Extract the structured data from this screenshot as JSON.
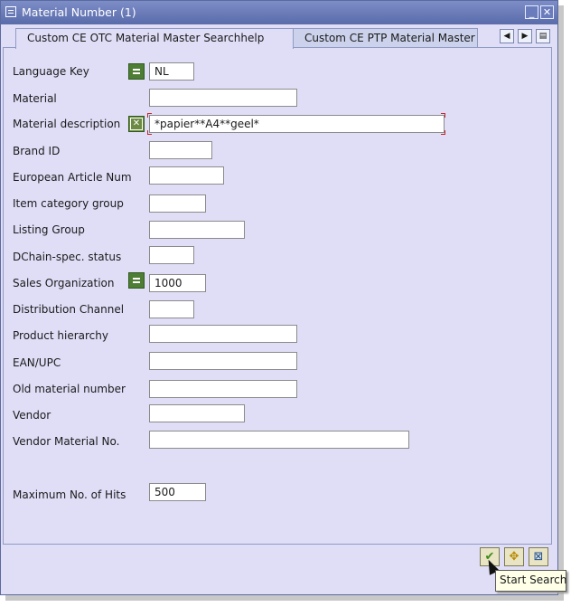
{
  "window": {
    "title": "Material Number (1)"
  },
  "tabs": [
    {
      "label": "Custom CE OTC Material Master Searchhelp",
      "active": true
    },
    {
      "label": "Custom CE PTP Material Master ...",
      "active": false
    }
  ],
  "form": {
    "fields": [
      {
        "label": "Language Key",
        "value": "NL"
      },
      {
        "label": "Material",
        "value": ""
      },
      {
        "label": "Material description",
        "value": "*papier**A4**geel*"
      },
      {
        "label": "Brand ID",
        "value": ""
      },
      {
        "label": "European Article Num",
        "value": ""
      },
      {
        "label": "Item category group",
        "value": ""
      },
      {
        "label": "Listing Group",
        "value": ""
      },
      {
        "label": "DChain-spec. status",
        "value": ""
      },
      {
        "label": "Sales Organization",
        "value": "1000"
      },
      {
        "label": "Distribution Channel",
        "value": ""
      },
      {
        "label": "Product hierarchy",
        "value": ""
      },
      {
        "label": "EAN/UPC",
        "value": ""
      },
      {
        "label": "Old material number",
        "value": ""
      },
      {
        "label": "Vendor",
        "value": ""
      },
      {
        "label": "Vendor Material No.",
        "value": ""
      }
    ],
    "max_hits": {
      "label": "Maximum No. of Hits",
      "value": "500"
    }
  },
  "tooltip": {
    "text": "Start Search"
  },
  "colors": {
    "accent": "#5a6bab",
    "panel": "#e0def7",
    "required_marker": "#c0282a"
  }
}
